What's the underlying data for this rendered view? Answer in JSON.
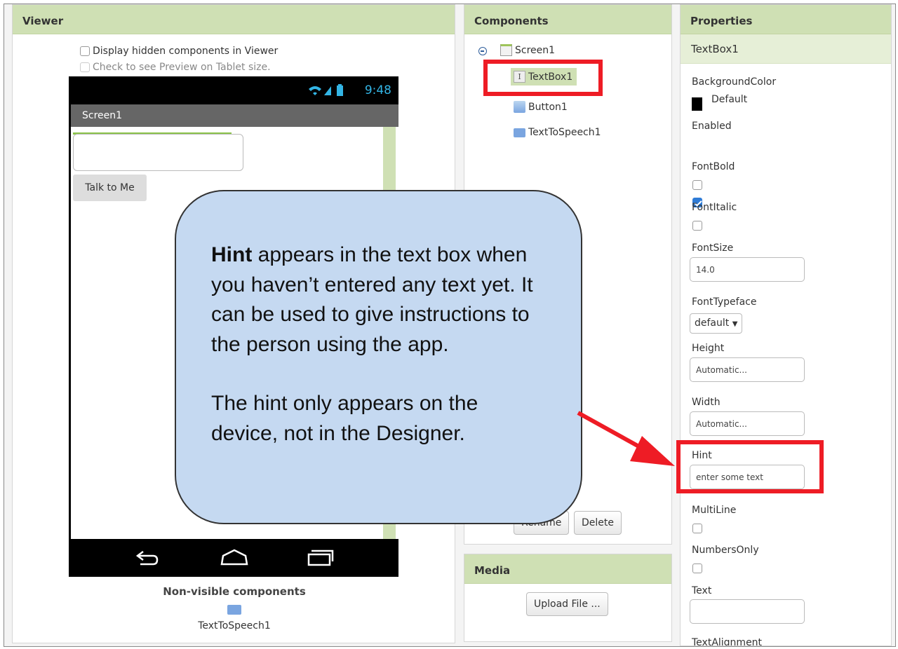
{
  "viewer": {
    "header": "Viewer",
    "display_hidden_label": "Display hidden components in Viewer",
    "tablet_preview_label": "Check to see Preview on Tablet size.",
    "phone": {
      "status_time": "9:48",
      "screen_title": "Screen1",
      "button_label": "Talk to Me"
    },
    "nonvisible_title": "Non-visible components",
    "nonvisible_item": "TextToSpeech1"
  },
  "components": {
    "header": "Components",
    "tree": [
      {
        "label": "Screen1",
        "icon": "screen-icon"
      },
      {
        "label": "TextBox1",
        "icon": "textbox-icon",
        "selected": true
      },
      {
        "label": "Button1",
        "icon": "button-icon"
      },
      {
        "label": "TextToSpeech1",
        "icon": "speech-icon"
      }
    ],
    "rename_label": "Rename",
    "delete_label": "Delete"
  },
  "media": {
    "header": "Media",
    "upload_label": "Upload File ..."
  },
  "properties": {
    "header": "Properties",
    "selected_component": "TextBox1",
    "background_color_label": "BackgroundColor",
    "background_color_value": "Default",
    "enabled_label": "Enabled",
    "fontbold_label": "FontBold",
    "fontitalic_label": "FontItalic",
    "fontsize_label": "FontSize",
    "fontsize_value": "14.0",
    "fonttypeface_label": "FontTypeface",
    "fonttypeface_value": "default",
    "height_label": "Height",
    "height_value": "Automatic...",
    "width_label": "Width",
    "width_value": "Automatic...",
    "hint_label": "Hint",
    "hint_value": "enter some text",
    "multiline_label": "MultiLine",
    "numbersonly_label": "NumbersOnly",
    "text_label": "Text",
    "text_value": "",
    "textalignment_label": "TextAlignment"
  },
  "callout": {
    "bold_word": "Hint",
    "line1_rest": " appears in the text box when",
    "line2": "you haven’t entered any text yet. It",
    "line3": "can be used to give instructions to",
    "line4": "the person using the app.",
    "line5": "The hint only appears on the",
    "line6": "device, not in the Designer."
  },
  "colors": {
    "panel_header": "#cfe0b4",
    "highlight_red": "#ee1c25",
    "callout_fill": "#c5d9f1",
    "status_blue": "#33b5e5"
  }
}
